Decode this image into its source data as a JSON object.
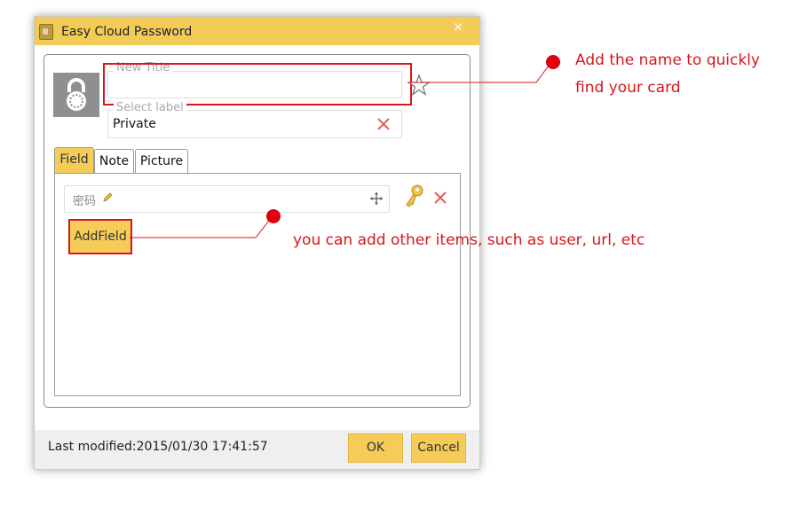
{
  "window": {
    "title": "Easy Cloud Password",
    "close_glyph": "×"
  },
  "card": {
    "title_placeholder": "New Title",
    "title_value": "",
    "label_placeholder": "Select label",
    "label_value": "Private"
  },
  "tabs": [
    {
      "label": "Field",
      "active": true
    },
    {
      "label": "Note",
      "active": false
    },
    {
      "label": "Picture",
      "active": false
    }
  ],
  "fields": [
    {
      "label": "密码"
    }
  ],
  "add_field_label": "AddField",
  "footer": {
    "last_modified": "Last modified:2015/01/30 17:41:57",
    "ok_label": "OK",
    "cancel_label": "Cancel"
  },
  "annotations": {
    "title_note_line1": "Add the name to quickly",
    "title_note_line2": "find your card",
    "field_note": "you can add other items, such as user, url, etc"
  },
  "colors": {
    "accent": "#f6cc58",
    "titlebar": "#f3cb57",
    "annotation_red": "#d8161c",
    "icon_gray": "#8f8f8f"
  }
}
